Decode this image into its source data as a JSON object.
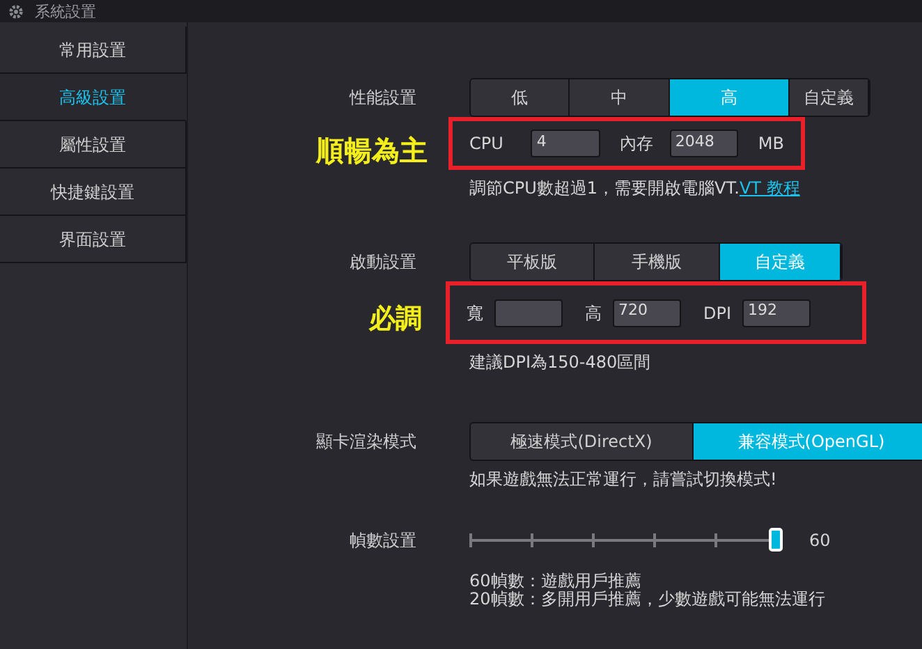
{
  "window": {
    "title": "系統設置"
  },
  "sidebar": {
    "items": [
      {
        "label": "常用設置",
        "selected": false
      },
      {
        "label": "高級設置",
        "selected": true
      },
      {
        "label": "屬性設置",
        "selected": false
      },
      {
        "label": "快捷鍵設置",
        "selected": false
      },
      {
        "label": "界面設置",
        "selected": false
      }
    ]
  },
  "performance": {
    "label": "性能設置",
    "options": [
      {
        "label": "低",
        "selected": false
      },
      {
        "label": "中",
        "selected": false
      },
      {
        "label": "高",
        "selected": true
      },
      {
        "label": "自定義",
        "selected": false
      }
    ],
    "annotation": "順暢為主",
    "fields": [
      {
        "label": "CPU",
        "value": "4"
      },
      {
        "label": "內存",
        "value": "2048",
        "unit": "MB"
      }
    ],
    "hint": "調節CPU數超過1，需要開啟電腦VT.",
    "link": "VT 教程"
  },
  "launch": {
    "label": "啟動設置",
    "options": [
      {
        "label": "平板版",
        "selected": false
      },
      {
        "label": "手機版",
        "selected": false
      },
      {
        "label": "自定義",
        "selected": true
      }
    ],
    "annotation": "必調",
    "fields": [
      {
        "label": "寬"
      },
      {
        "label": "高",
        "value": "720"
      },
      {
        "label": "DPI",
        "value": "192"
      }
    ],
    "hint": "建議DPI為150-480區間"
  },
  "renderer": {
    "label": "顯卡渲染模式",
    "options": [
      {
        "label": "極速模式(DirectX)",
        "selected": false
      },
      {
        "label": "兼容模式(OpenGL)",
        "selected": true
      }
    ],
    "hint": "如果遊戲無法正常運行，請嘗試切換模式!"
  },
  "frame_rate": {
    "label": "幀數設置",
    "level": 1,
    "reading": "60",
    "notes": [
      "60幀數：遊戲用戶推薦",
      "20幀數：多開用戶推薦，少數遊戲可能無法運行"
    ]
  }
}
